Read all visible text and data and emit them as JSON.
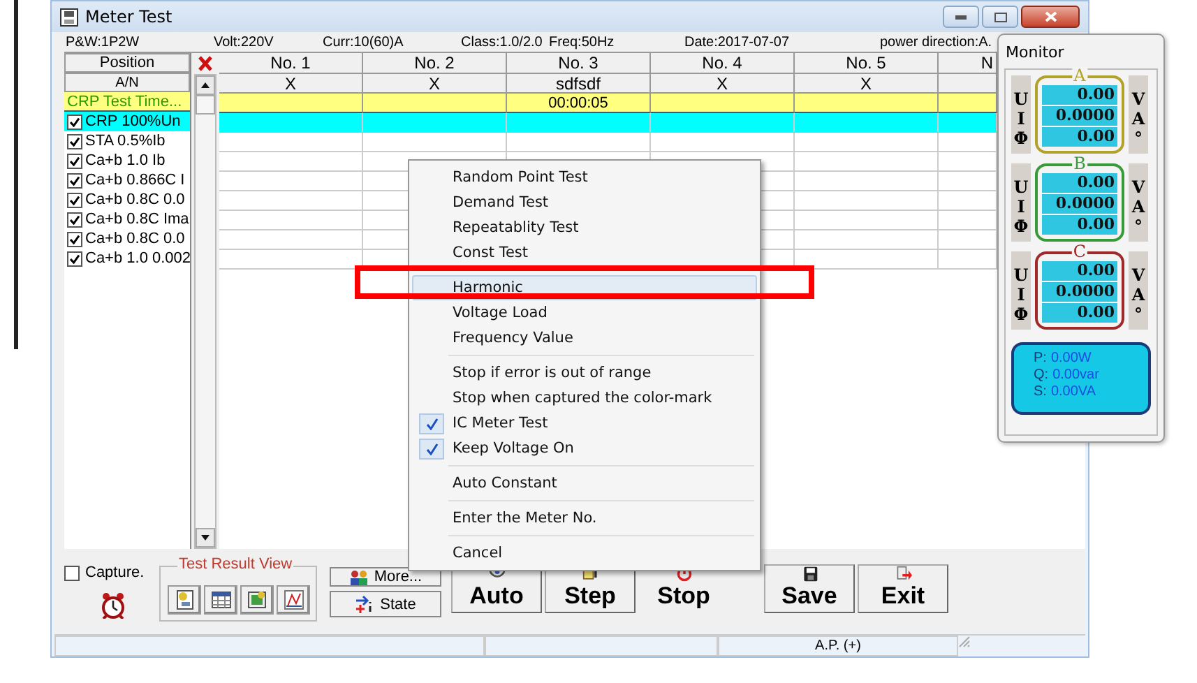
{
  "window": {
    "title": "Meter Test"
  },
  "info_bar": [
    "P&W:1P2W",
    "Volt:220V",
    "Curr:10(60)A",
    "Class:1.0/2.0",
    "Freq:50Hz",
    "Date:2017-07-07",
    "power direction:A."
  ],
  "grid": {
    "position_header": "Position",
    "an_header": "A/N",
    "time_label": "CRP Test Time...",
    "columns": [
      {
        "label": "No. 1",
        "a_n": "X"
      },
      {
        "label": "No. 2",
        "a_n": "X"
      },
      {
        "label": "No. 3",
        "a_n": "sdfsdf",
        "test_time": "00:00:05"
      },
      {
        "label": "No. 4",
        "a_n": "X"
      },
      {
        "label": "No. 5",
        "a_n": "X"
      },
      {
        "label": "N"
      }
    ],
    "items": [
      {
        "label": "CRP 100%Un",
        "checked": true,
        "selected": true
      },
      {
        "label": "STA 0.5%Ib",
        "checked": true,
        "selected": false
      },
      {
        "label": "Ca+b 1.0 Ib",
        "checked": true,
        "selected": false
      },
      {
        "label": "Ca+b 0.866C I",
        "checked": true,
        "selected": false
      },
      {
        "label": "Ca+b 0.8C 0.0",
        "checked": true,
        "selected": false
      },
      {
        "label": "Ca+b 0.8C Ima",
        "checked": true,
        "selected": false
      },
      {
        "label": "Ca+b 0.8C 0.0",
        "checked": true,
        "selected": false
      },
      {
        "label": "Ca+b 1.0 0.002",
        "checked": true,
        "selected": false
      }
    ]
  },
  "capture": {
    "label": "Capture.",
    "checked": false
  },
  "result_view": {
    "title": "Test Result View"
  },
  "small_buttons": [
    {
      "label": "More...",
      "kind": "more"
    },
    {
      "label": "State",
      "kind": "state"
    }
  ],
  "big_buttons": [
    {
      "label": "Auto",
      "kind": "auto",
      "pressed": false
    },
    {
      "label": "Step",
      "kind": "step",
      "pressed": false
    },
    {
      "label": "Stop",
      "kind": "stop",
      "pressed": true
    },
    {
      "label": "Save",
      "kind": "save",
      "pressed": false
    },
    {
      "label": "Exit",
      "kind": "exit",
      "pressed": false
    }
  ],
  "status_bar": [
    "A.P. (+)"
  ],
  "context_menu": {
    "groups": [
      [
        {
          "label": "Random Point Test",
          "checked": false,
          "highlighted": false,
          "outlined": false
        },
        {
          "label": "Demand Test",
          "checked": false,
          "highlighted": false,
          "outlined": false
        },
        {
          "label": "Repeatablity Test",
          "checked": false,
          "highlighted": false,
          "outlined": false
        },
        {
          "label": "Const Test",
          "checked": false,
          "highlighted": false,
          "outlined": false
        }
      ],
      [
        {
          "label": "Harmonic",
          "checked": false,
          "highlighted": true,
          "outlined": true
        },
        {
          "label": "Voltage Load",
          "checked": false,
          "highlighted": false,
          "outlined": false
        },
        {
          "label": "Frequency Value",
          "checked": false,
          "highlighted": false,
          "outlined": false
        }
      ],
      [
        {
          "label": "Stop if error is out of range",
          "checked": false,
          "highlighted": false,
          "outlined": false
        },
        {
          "label": "Stop when captured the color-mark",
          "checked": false,
          "highlighted": false,
          "outlined": false
        },
        {
          "label": "IC Meter Test",
          "checked": true,
          "highlighted": false,
          "outlined": false
        },
        {
          "label": "Keep Voltage On",
          "checked": true,
          "highlighted": false,
          "outlined": false
        }
      ],
      [
        {
          "label": "Auto Constant",
          "checked": false,
          "highlighted": false,
          "outlined": false
        }
      ],
      [
        {
          "label": "Enter the Meter No.",
          "checked": false,
          "highlighted": false,
          "outlined": false
        }
      ],
      [
        {
          "label": "Cancel",
          "checked": false,
          "highlighted": false,
          "outlined": false
        }
      ]
    ]
  },
  "monitor": {
    "title": "Monitor",
    "phases": [
      {
        "name": "A",
        "color": "#b0a22a",
        "readings": [
          {
            "symbol": "U",
            "value": "0.00",
            "unit": "V"
          },
          {
            "symbol": "I",
            "value": "0.0000",
            "unit": "A"
          },
          {
            "symbol": "Φ",
            "value": "0.00",
            "unit": "°"
          }
        ]
      },
      {
        "name": "B",
        "color": "#3a9a3a",
        "readings": [
          {
            "symbol": "U",
            "value": "0.00",
            "unit": "V"
          },
          {
            "symbol": "I",
            "value": "0.0000",
            "unit": "A"
          },
          {
            "symbol": "Φ",
            "value": "0.00",
            "unit": "°"
          }
        ]
      },
      {
        "name": "C",
        "color": "#a02a2a",
        "readings": [
          {
            "symbol": "U",
            "value": "0.00",
            "unit": "V"
          },
          {
            "symbol": "I",
            "value": "0.0000",
            "unit": "A"
          },
          {
            "symbol": "Φ",
            "value": "0.00",
            "unit": "°"
          }
        ]
      }
    ],
    "totals": [
      {
        "label": "P:",
        "value": "0.00W"
      },
      {
        "label": "Q:",
        "value": "0.00var"
      },
      {
        "label": "S:",
        "value": "0.00VA"
      }
    ]
  }
}
